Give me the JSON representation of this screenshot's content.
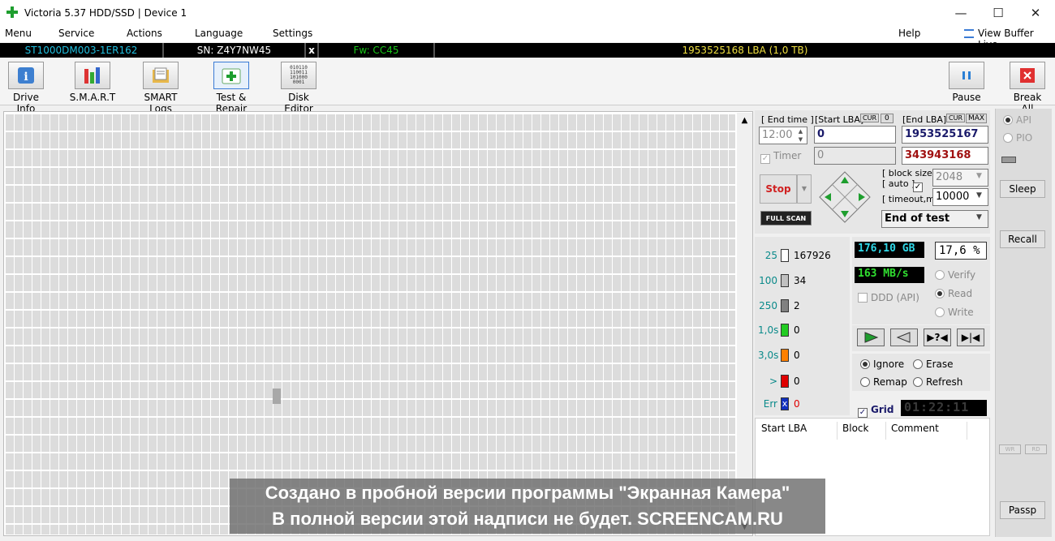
{
  "window": {
    "title": "Victoria 5.37 HDD/SSD | Device 1",
    "minimize": "—",
    "maximize": "☐",
    "close": "✕"
  },
  "menu": {
    "items": [
      "Menu",
      "Service",
      "Actions",
      "Language",
      "Settings"
    ],
    "help": "Help",
    "view_buffer": "View Buffer Live"
  },
  "device": {
    "model": "ST1000DM003-1ER162",
    "serial": "SN: Z4Y7NW45",
    "close_x": "x",
    "firmware": "Fw: CC45",
    "lba": "1953525168 LBA (1,0 TB)",
    "colors": {
      "model": "#20c0e0",
      "serial": "#ffffff",
      "firmware": "#18c818",
      "lba": "#f0e040"
    }
  },
  "toolbar": {
    "drive_info": "Drive Info",
    "smart": "S.M.A.R.T",
    "smart_logs": "SMART Logs",
    "test_repair": "Test & Repair",
    "disk_editor": "Disk Editor",
    "pause": "Pause",
    "break_all": "Break All"
  },
  "test": {
    "end_time_label": "[ End time ]",
    "end_time_value": "12:00",
    "timer_label": "Timer",
    "timer_value": "0",
    "start_lba_label": "[Start LBA]",
    "cur": "CUR",
    "zero": "0",
    "start_lba_value": "0",
    "end_lba_label": "[End LBA]",
    "max": "MAX",
    "end_lba_value": "1953525167",
    "current_lba": "343943168",
    "stop": "Stop",
    "full_scan": "FULL SCAN",
    "block_size_label": "[ block size ]",
    "auto_label": "[ auto ]",
    "block_size_value": "2048",
    "timeout_label": "[ timeout,ms ]",
    "timeout_value": "10000",
    "end_action": "End of test"
  },
  "legend": [
    {
      "label": "25",
      "color": "#ffffff",
      "count": "167926"
    },
    {
      "label": "100",
      "color": "#c0c0c0",
      "count": "34"
    },
    {
      "label": "250",
      "color": "#808080",
      "count": "2"
    },
    {
      "label": "1,0s",
      "color": "#22cc22",
      "count": "0"
    },
    {
      "label": "3,0s",
      "color": "#ff8000",
      "count": "0"
    },
    {
      "label": ">",
      "color": "#e00000",
      "count": "0"
    },
    {
      "label": "Err",
      "color": "#1030c0",
      "count": "0"
    }
  ],
  "stats": {
    "scanned": "176,10 GB",
    "percent": "17,6  %",
    "speed": "163 MB/s",
    "ddd": "DDD (API)",
    "verify": "Verify",
    "read": "Read",
    "write": "Write"
  },
  "repair": {
    "ignore": "Ignore",
    "erase": "Erase",
    "remap": "Remap",
    "refresh": "Refresh",
    "grid": "Grid",
    "elapsed": "01:22:11"
  },
  "log": {
    "col_start": "Start LBA",
    "col_block": "Block",
    "col_comment": "Comment"
  },
  "right": {
    "api": "API",
    "pio": "PIO",
    "sleep": "Sleep",
    "recall": "Recall",
    "wr": "WR",
    "rd": "RD",
    "passp": "Passp"
  },
  "watermark": {
    "line1": "Создано в пробной версии программы \"Экранная Камера\"",
    "line2": "В полной версии этой надписи не будет. SCREENCAM.RU"
  }
}
